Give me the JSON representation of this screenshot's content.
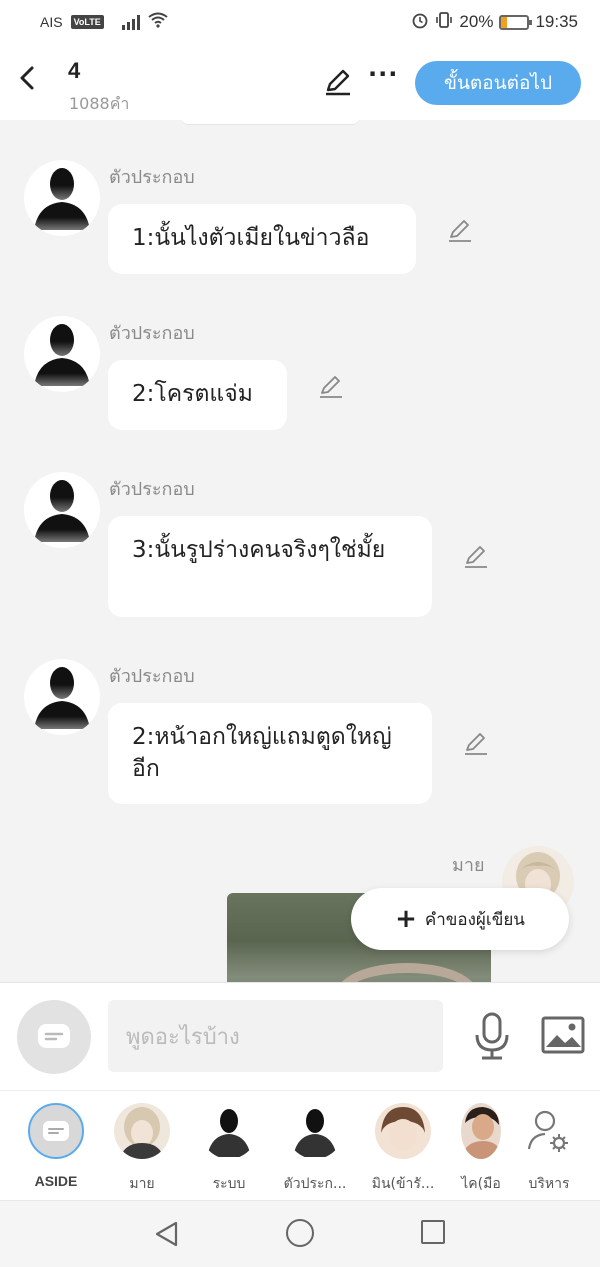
{
  "status_bar": {
    "carrier": "AIS",
    "volte": "VoLTE",
    "battery_percent": "20%",
    "battery_level": 0.2,
    "time": "19:35"
  },
  "header": {
    "title": "4",
    "word_count": "1088คำ",
    "next_label": "ขั้นตอนต่อไป"
  },
  "messages": [
    {
      "sender": "ตัวประกอบ",
      "text": "1:นั้นไงตัวเมียในข่าวลือ"
    },
    {
      "sender": "ตัวประกอบ",
      "text": "2:โครตแจ่ม"
    },
    {
      "sender": "ตัวประกอบ",
      "text": "3:นั้นรูปร่างคนจริงๆใช่มั้ย"
    },
    {
      "sender": "ตัวประกอบ",
      "text": "2:หน้าอกใหญ่แถมตูดใหญ่อีก"
    }
  ],
  "right_message": {
    "sender": "มาย"
  },
  "author_note_label": "คำของผู้เขียน",
  "input": {
    "placeholder": "พูดอะไรบ้าง"
  },
  "characters": [
    {
      "label": "ASIDE"
    },
    {
      "label": "มาย"
    },
    {
      "label": "ระบบ"
    },
    {
      "label": "ตัวประก..."
    },
    {
      "label": "มิน(ข้ารั..."
    },
    {
      "label": "ไค(มือ"
    },
    {
      "label": "บริหาร"
    }
  ],
  "colors": {
    "accent": "#5aabee",
    "background": "#f3f3f3"
  }
}
